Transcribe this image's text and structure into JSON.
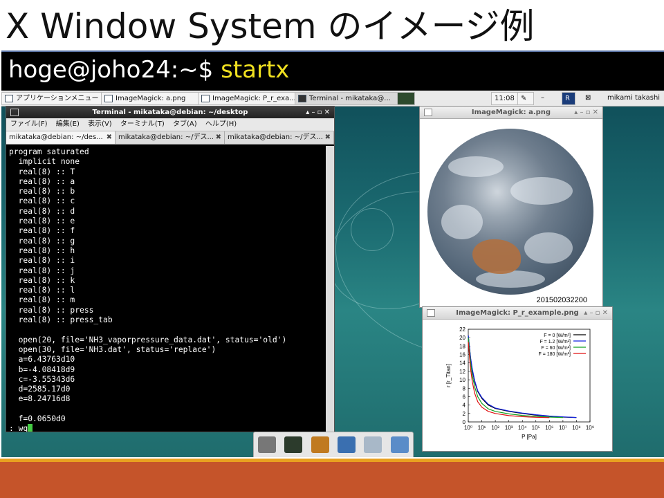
{
  "slide": {
    "title": "X Window System のイメージ例",
    "prompt": "hoge@joho24:~$",
    "command": "startx"
  },
  "taskbar": {
    "app_menu": "アプリケーションメニュー",
    "items": [
      {
        "label": "ImageMagick: a.png"
      },
      {
        "label": "ImageMagick: P_r_exa..."
      },
      {
        "label": "Terminal - mikataka@..."
      }
    ],
    "clock": "11:08",
    "user": "mikami takashi"
  },
  "terminal": {
    "title": "Terminal - mikataka@debian: ~/desktop",
    "controls": "▴ – ▫ ✕",
    "menu": [
      "ファイル(F)",
      "編集(E)",
      "表示(V)",
      "ターミナル(T)",
      "タブ(A)",
      "ヘルプ(H)"
    ],
    "tabs": [
      {
        "label": "mikataka@debian: ~/des..."
      },
      {
        "label": "mikataka@debian: ~/デス..."
      },
      {
        "label": "mikataka@debian: ~/デス..."
      }
    ],
    "lines": [
      "program saturated",
      "  implicit none",
      "  real(8) :: T",
      "  real(8) :: a",
      "  real(8) :: b",
      "  real(8) :: c",
      "  real(8) :: d",
      "  real(8) :: e",
      "  real(8) :: f",
      "  real(8) :: g",
      "  real(8) :: h",
      "  real(8) :: i",
      "  real(8) :: j",
      "  real(8) :: k",
      "  real(8) :: l",
      "  real(8) :: m",
      "  real(8) :: press",
      "  real(8) :: press_tab",
      "",
      "  open(20, file='NH3_vaporpressure_data.dat', status='old')",
      "  open(30, file='NH3.dat', status='replace')",
      "  a=6.43763d10",
      "  b=-4.08418d9",
      "  c=-3.55343d6",
      "  d=2585.17d0",
      "  e=8.24716d8",
      "",
      "  f=0.0650d0"
    ],
    "command_line": ": wq"
  },
  "image_window_earth": {
    "title": "ImageMagick: a.png",
    "controls": "▴ – ▫ ✕",
    "label": "201502032200"
  },
  "image_window_chart": {
    "title": "ImageMagick: P_r_example.png",
    "controls": "▴ – ▫ ✕"
  },
  "chart_data": {
    "type": "line",
    "xlabel": "P [Pa]",
    "ylabel": "r [r_Titan]",
    "xscale": "log",
    "xlim": [
      1,
      1000000000
    ],
    "ylim": [
      0,
      22
    ],
    "xticks": [
      "10⁰",
      "10¹",
      "10²",
      "10³",
      "10⁴",
      "10⁵",
      "10⁶",
      "10⁷",
      "10⁸",
      "10⁹"
    ],
    "yticks": [
      0,
      2,
      4,
      6,
      8,
      10,
      12,
      14,
      16,
      18,
      20,
      22
    ],
    "legend_position": "top-right",
    "series": [
      {
        "name": "F = 0 [W/m²]",
        "color": "#000000",
        "x": [
          1.0,
          1.5,
          2,
          3,
          5,
          10,
          30,
          100,
          1000,
          10000,
          100000,
          1000000,
          10000000,
          100000000
        ],
        "y": [
          20.5,
          15,
          12.2,
          9.5,
          7.2,
          5.6,
          4.0,
          3.2,
          2.5,
          2.0,
          1.6,
          1.35,
          1.15,
          1.05
        ]
      },
      {
        "name": "F = 1.2 [W/m²]",
        "color": "#1020e0",
        "x": [
          1.0,
          1.5,
          2,
          3,
          5,
          10,
          30,
          100,
          1000,
          10000,
          100000,
          1000000,
          10000000,
          100000000
        ],
        "y": [
          20.5,
          15.2,
          12.5,
          9.8,
          7.4,
          5.8,
          4.2,
          3.3,
          2.6,
          2.1,
          1.7,
          1.4,
          1.2,
          1.05
        ]
      },
      {
        "name": "F = 60 [W/m²]",
        "color": "#10a020",
        "x": [
          1.0,
          1.5,
          2,
          3,
          5,
          10,
          30,
          100,
          1000,
          10000,
          100000,
          1000000,
          10000000
        ],
        "y": [
          20.0,
          14,
          11,
          8.3,
          6.0,
          4.4,
          3.1,
          2.5,
          1.9,
          1.55,
          1.3,
          1.15,
          1.05
        ]
      },
      {
        "name": "F = 180 [W/m²]",
        "color": "#e01010",
        "x": [
          1.0,
          1.5,
          2,
          3,
          5,
          10,
          30,
          100,
          1000,
          10000,
          100000,
          1000000
        ],
        "y": [
          19.0,
          12.5,
          9.5,
          6.8,
          4.8,
          3.5,
          2.5,
          2.0,
          1.5,
          1.25,
          1.1,
          1.02
        ]
      }
    ]
  },
  "dock": {
    "items": [
      {
        "name": "show-desktop-icon",
        "color": "#777777"
      },
      {
        "name": "terminal-icon",
        "color": "#2c3b2c"
      },
      {
        "name": "file-manager-icon",
        "color": "#c07a20"
      },
      {
        "name": "web-browser-icon",
        "color": "#3a6fb0"
      },
      {
        "name": "app-finder-icon",
        "color": "#a8b8c8"
      },
      {
        "name": "folder-icon",
        "color": "#5a8cc8"
      }
    ]
  },
  "colors": {
    "command": "#f0e020",
    "accent_band": "#c5542a",
    "accent_stripe": "#e8a020"
  }
}
